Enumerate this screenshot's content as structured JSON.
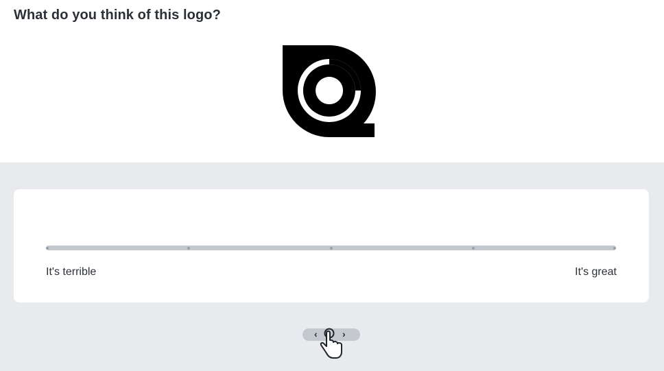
{
  "question": {
    "title": "What do you think of this logo?"
  },
  "logo": {
    "icon": "rings-logo-icon",
    "color": "#000000"
  },
  "rating": {
    "min_label": "It's terrible",
    "max_label": "It's great",
    "steps": 5,
    "track_color": "#c3c8cf"
  },
  "hint": {
    "left_glyph": "‹",
    "right_glyph": "›",
    "icon": "swipe-hand-icon"
  },
  "colors": {
    "background_band": "#e8eaee",
    "card": "#ffffff",
    "text": "#2b2f36"
  }
}
